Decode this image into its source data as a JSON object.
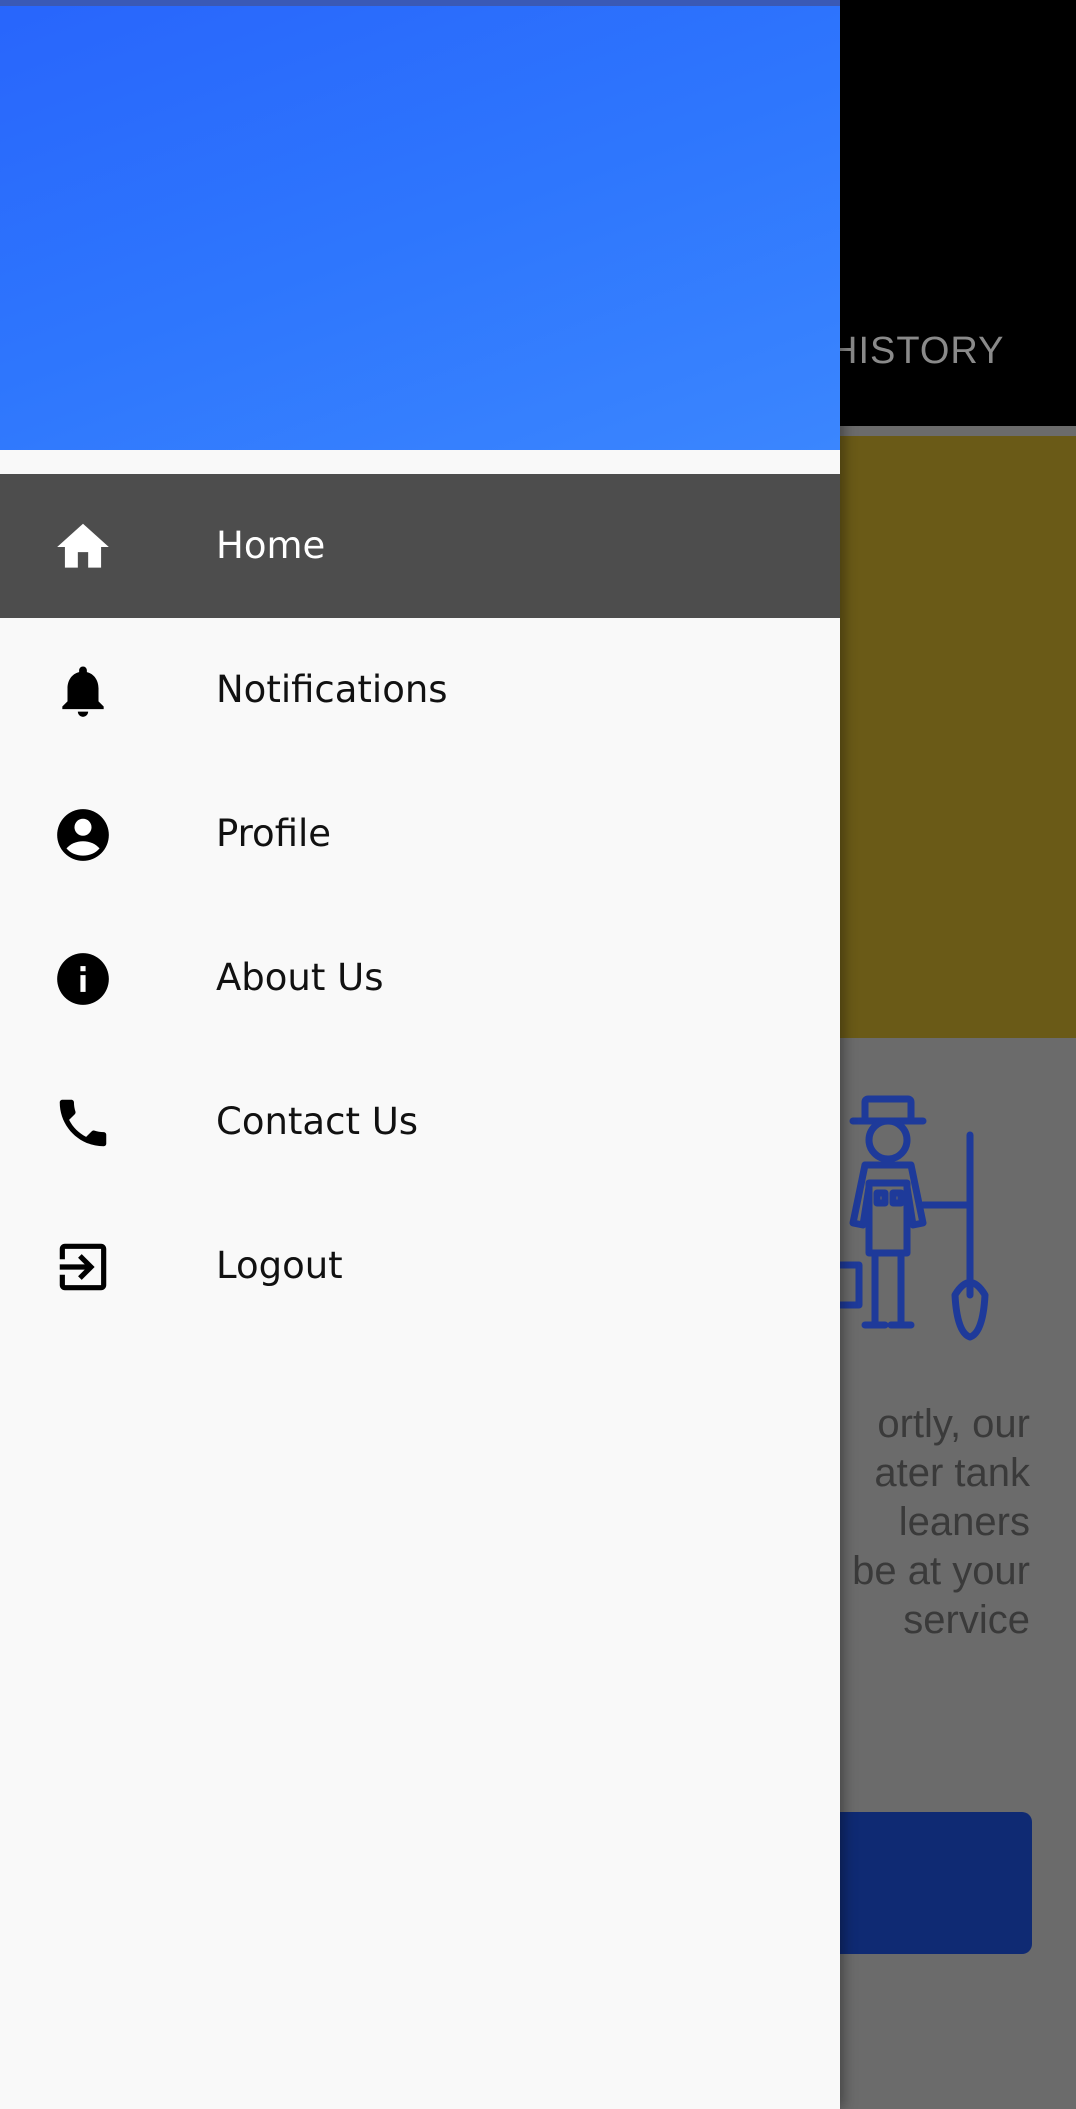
{
  "background_app": {
    "tab_label": "HISTORY",
    "message_lines": [
      "ortly, our",
      "ater tank",
      "leaners",
      "be at your",
      "service"
    ]
  },
  "drawer": {
    "menu": [
      {
        "label": "Home",
        "icon": "home-icon",
        "active": true
      },
      {
        "label": "Notifications",
        "icon": "bell-icon",
        "active": false
      },
      {
        "label": "Profile",
        "icon": "account-circle-icon",
        "active": false
      },
      {
        "label": "About Us",
        "icon": "info-icon",
        "active": false
      },
      {
        "label": "Contact Us",
        "icon": "phone-icon",
        "active": false
      },
      {
        "label": "Logout",
        "icon": "logout-icon",
        "active": false
      }
    ]
  },
  "colors": {
    "drawer_header_gradient": [
      "#2865fc",
      "#3b86fe"
    ],
    "active_item_bg": "#4d4d4d",
    "banner_bg": "#6a5a17",
    "cta_bg": "#0f2a73"
  }
}
